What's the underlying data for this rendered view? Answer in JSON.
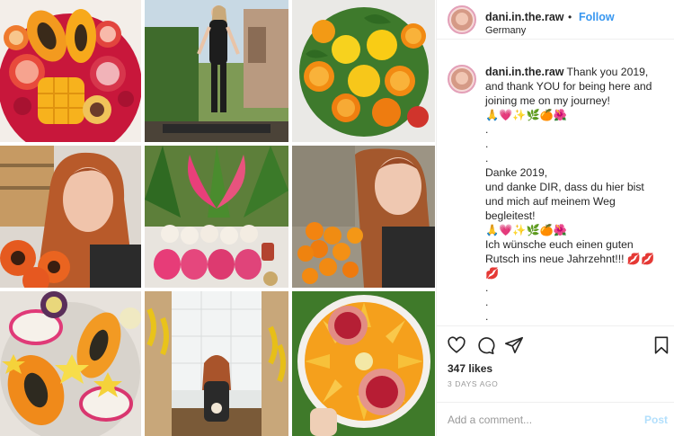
{
  "header": {
    "username": "dani.in.the.raw",
    "separator": "•",
    "follow_label": "Follow",
    "location": "Germany"
  },
  "caption": {
    "username": "dani.in.the.raw",
    "lines": [
      "Thank you 2019,",
      "and thank YOU for being here and",
      "joining me on my journey!",
      "🙏💗✨🌿🍊🌺",
      ".",
      ".",
      ".",
      "Danke 2019,",
      "und danke DIR, dass du hier bist",
      "und mich auf meinem Weg",
      "begleitest!",
      "🙏💗✨🌿🍊🌺",
      "Ich wünsche euch einen guten",
      "Rutsch ins neue Jahrzehnt!!! 💋💋",
      "💋",
      ".",
      ".",
      "."
    ]
  },
  "actions": {
    "like_icon": "heart-icon",
    "comment_icon": "comment-icon",
    "share_icon": "share-icon",
    "save_icon": "bookmark-icon",
    "likes": "347 likes",
    "date": "3 DAYS AGO"
  },
  "comment": {
    "placeholder": "Add a comment...",
    "post_label": "Post"
  },
  "colors": {
    "link_blue": "#3897f0",
    "post_disabled": "#b2dffc",
    "muted": "#999999",
    "border": "#efefef"
  }
}
